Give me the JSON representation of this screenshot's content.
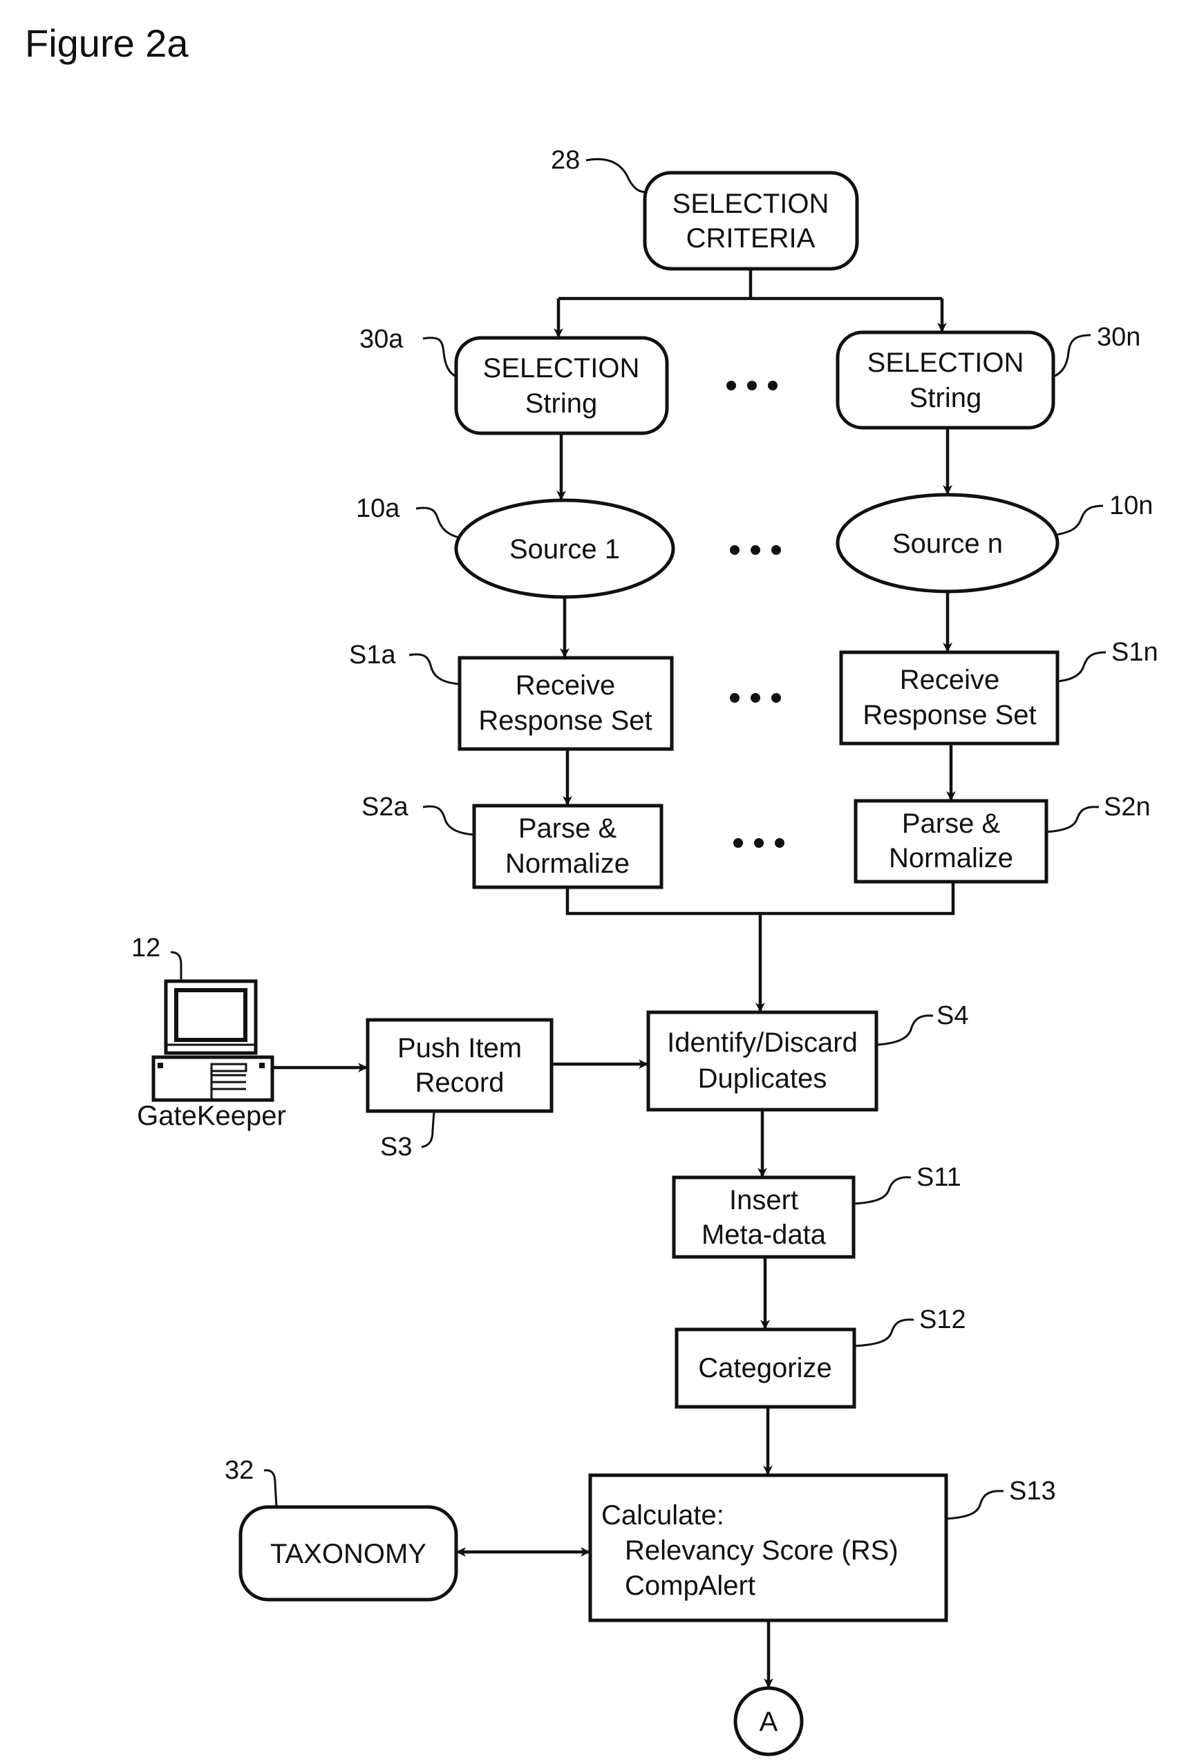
{
  "figure": {
    "title": "Figure 2a"
  },
  "nodes": {
    "selection_criteria": {
      "ref": "28",
      "lines": [
        "SELECTION",
        "CRITERIA"
      ]
    },
    "selection_string_a": {
      "ref": "30a",
      "lines": [
        "SELECTION",
        "String"
      ]
    },
    "selection_string_n": {
      "ref": "30n",
      "lines": [
        "SELECTION",
        "String"
      ]
    },
    "source_a": {
      "ref": "10a",
      "label": "Source 1"
    },
    "source_n": {
      "ref": "10n",
      "label": "Source n"
    },
    "receive_a": {
      "ref": "S1a",
      "lines": [
        "Receive",
        "Response Set"
      ]
    },
    "receive_n": {
      "ref": "S1n",
      "lines": [
        "Receive",
        "Response Set"
      ]
    },
    "parse_a": {
      "ref": "S2a",
      "lines": [
        "Parse &",
        "Normalize"
      ]
    },
    "parse_n": {
      "ref": "S2n",
      "lines": [
        "Parse &",
        "Normalize"
      ]
    },
    "gatekeeper": {
      "ref": "12",
      "label": "GateKeeper"
    },
    "push_item": {
      "ref": "S3",
      "lines": [
        "Push Item",
        "Record"
      ]
    },
    "identify": {
      "ref": "S4",
      "lines": [
        "Identify/Discard",
        "Duplicates"
      ]
    },
    "insert": {
      "ref": "S11",
      "lines": [
        "Insert",
        "Meta-data"
      ]
    },
    "categorize": {
      "ref": "S12",
      "label": "Categorize"
    },
    "calculate": {
      "ref": "S13",
      "lines": [
        "Calculate:",
        "Relevancy Score (RS)",
        "CompAlert"
      ]
    },
    "taxonomy": {
      "ref": "32",
      "label": "TAXONOMY"
    },
    "connector": {
      "label": "A"
    }
  },
  "ellipsis_symbol": "•••"
}
